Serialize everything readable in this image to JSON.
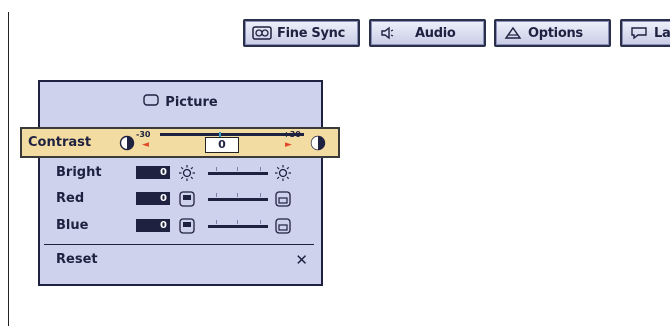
{
  "tabs": {
    "fine_sync": "Fine Sync",
    "audio": "Audio",
    "options": "Options",
    "language": "La"
  },
  "panel": {
    "title": "Picture",
    "contrast": {
      "label": "Contrast",
      "min": "-30",
      "max": "+30",
      "value": "0"
    },
    "rows": [
      {
        "label": "Bright",
        "value": "0"
      },
      {
        "label": "Red",
        "value": "0"
      },
      {
        "label": "Blue",
        "value": "0"
      }
    ],
    "reset": {
      "label": "Reset",
      "symbol": "✕"
    }
  },
  "colors": {
    "panel_bg": "#ced2ec",
    "highlight": "#f3dca2",
    "text": "#1e2140",
    "arrow": "#e0482a"
  }
}
